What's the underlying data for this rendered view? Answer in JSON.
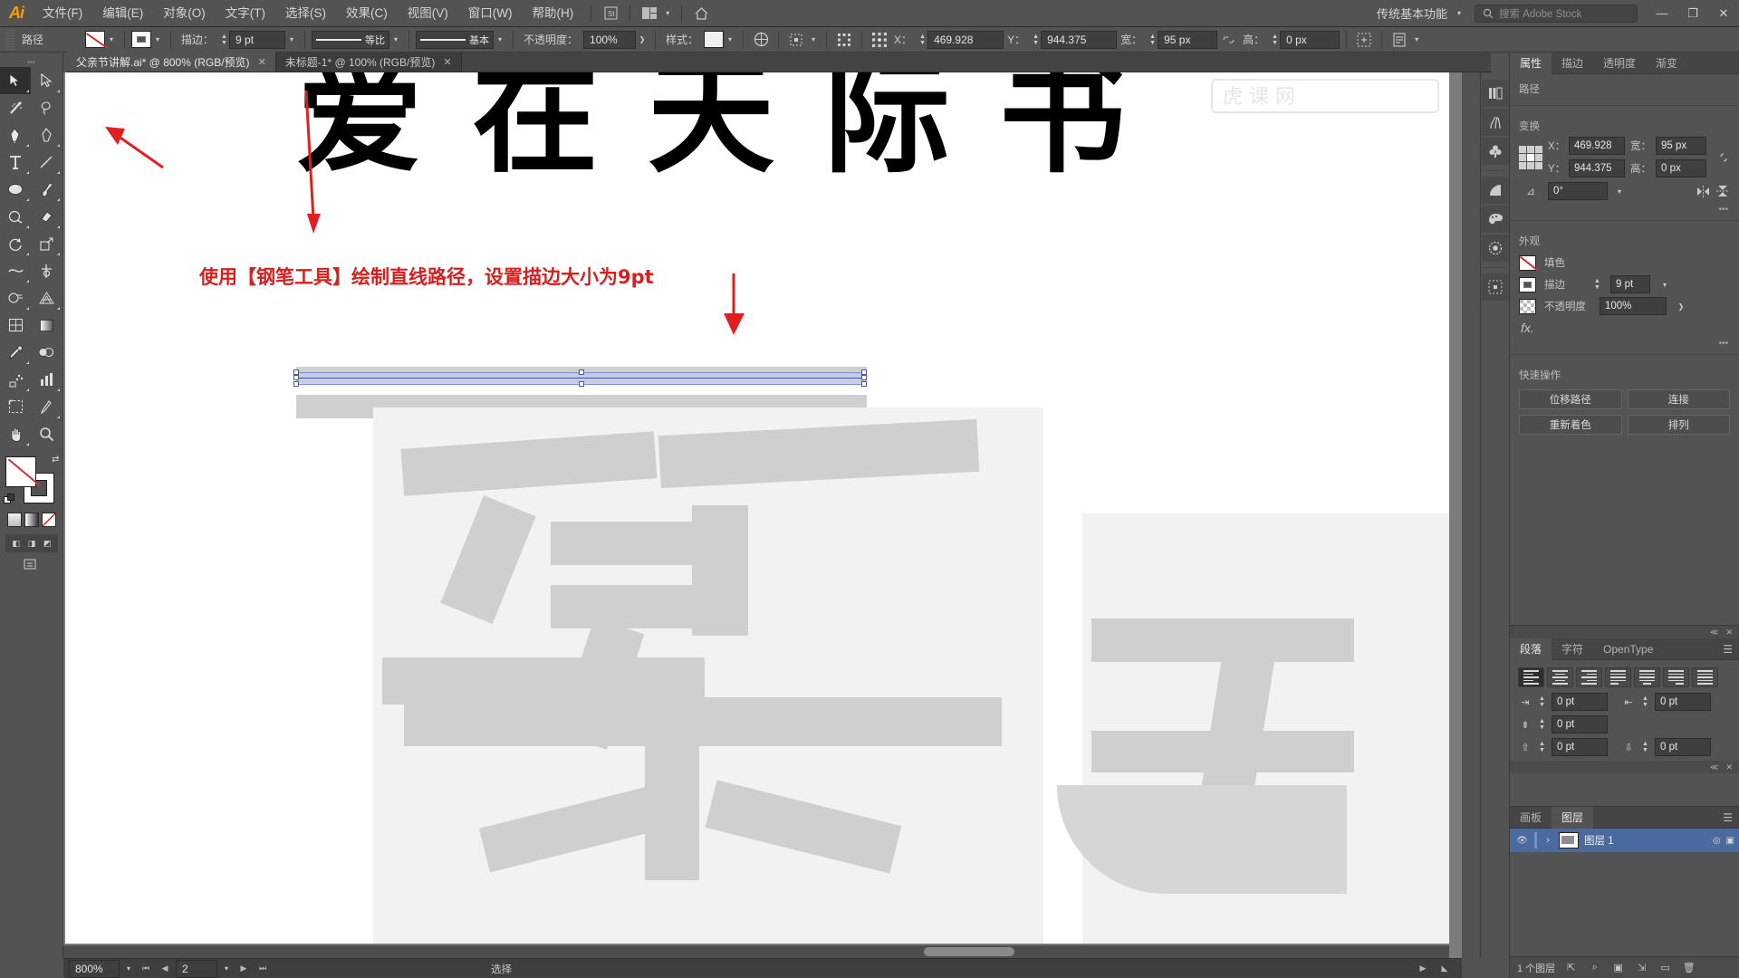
{
  "app": {
    "name": "Adobe Illustrator",
    "logo_text": "Ai"
  },
  "menubar": {
    "items": [
      {
        "label": "文件(F)"
      },
      {
        "label": "编辑(E)"
      },
      {
        "label": "对象(O)"
      },
      {
        "label": "文字(T)"
      },
      {
        "label": "选择(S)"
      },
      {
        "label": "效果(C)"
      },
      {
        "label": "视图(V)"
      },
      {
        "label": "窗口(W)"
      },
      {
        "label": "帮助(H)"
      }
    ],
    "workspace": "传统基本功能",
    "search_placeholder": "搜索 Adobe Stock",
    "window_buttons": {
      "minimize": "—",
      "maximize": "❐",
      "close": "✕"
    }
  },
  "controlbar": {
    "object_label": "路径",
    "fill_label": "填色",
    "stroke_label": "描边：",
    "stroke_weight": "9 pt",
    "stroke_profile": "等比",
    "brush_def": "基本",
    "opacity_label": "不透明度：",
    "opacity_value": "100%",
    "style_label": "样式：",
    "x_label": "X：",
    "x_value": "469.928",
    "y_label": "Y：",
    "y_value": "944.375",
    "w_label": "宽：",
    "w_value": "95 px",
    "h_label": "高：",
    "h_value": "0 px"
  },
  "tabs": [
    {
      "label": "父亲节讲解.ai* @ 800% (RGB/预览)",
      "active": true,
      "close": "✕"
    },
    {
      "label": "未标题-1* @ 100% (RGB/预览)",
      "active": false,
      "close": "✕"
    }
  ],
  "toolbar": {
    "tools": [
      {
        "name": "selection-tool",
        "glyph": "➤",
        "active": true
      },
      {
        "name": "direct-selection-tool",
        "glyph": "➢",
        "active": false
      },
      {
        "name": "magic-wand-tool",
        "glyph": "✧",
        "active": false
      },
      {
        "name": "lasso-tool",
        "glyph": "◌",
        "active": false
      },
      {
        "name": "pen-tool",
        "glyph": "✒",
        "active": false
      },
      {
        "name": "add-anchor-point-tool",
        "glyph": "✎",
        "active": false
      },
      {
        "name": "type-tool",
        "glyph": "T",
        "active": false
      },
      {
        "name": "line-segment-tool",
        "glyph": "╱",
        "active": false
      },
      {
        "name": "ellipse-tool",
        "glyph": "⬭",
        "active": false
      },
      {
        "name": "paintbrush-tool",
        "glyph": "🖌",
        "active": false
      },
      {
        "name": "shaper-tool",
        "glyph": "◔",
        "active": false
      },
      {
        "name": "eraser-tool",
        "glyph": "◇",
        "active": false
      },
      {
        "name": "rotate-tool",
        "glyph": "↻",
        "active": false
      },
      {
        "name": "scale-tool",
        "glyph": "⧉",
        "active": false
      },
      {
        "name": "width-tool",
        "glyph": "∿",
        "active": false
      },
      {
        "name": "free-transform-tool",
        "glyph": "✛",
        "active": false
      },
      {
        "name": "shape-builder-tool",
        "glyph": "◕",
        "active": false
      },
      {
        "name": "perspective-grid-tool",
        "glyph": "▦",
        "active": false
      },
      {
        "name": "mesh-tool",
        "glyph": "▩",
        "active": false
      },
      {
        "name": "gradient-tool",
        "glyph": "▤",
        "active": false
      },
      {
        "name": "eyedropper-tool",
        "glyph": "⚲",
        "active": false
      },
      {
        "name": "blend-tool",
        "glyph": "❂",
        "active": false
      },
      {
        "name": "symbol-sprayer-tool",
        "glyph": "⁂",
        "active": false
      },
      {
        "name": "column-graph-tool",
        "glyph": "▮",
        "active": false
      },
      {
        "name": "artboard-tool",
        "glyph": "⊡",
        "active": false
      },
      {
        "name": "slice-tool",
        "glyph": "✂",
        "active": false
      },
      {
        "name": "hand-tool",
        "glyph": "✋",
        "active": false
      },
      {
        "name": "zoom-tool",
        "glyph": "⌕",
        "active": false
      }
    ],
    "screen_modes": [
      "◧",
      "◨",
      "◩"
    ]
  },
  "canvas": {
    "headline_text": "爱在天际书",
    "annotation": "使用【钢笔工具】绘制直线路径，设置描边大小为9pt",
    "annotation_color": "#d81f1f",
    "selection": {
      "anchors": 6,
      "stroke_color": "#7b8fd4",
      "fill_color": "#c2cbe8"
    }
  },
  "statusbar": {
    "zoom": "800%",
    "page": "2",
    "status_text": "选择",
    "first_glyph": "⏮",
    "prev_glyph": "◀",
    "next_glyph": "▶",
    "last_glyph": "⏭"
  },
  "dockstrip": {
    "icons": [
      {
        "name": "libraries-icon",
        "glyph": "▦"
      },
      {
        "name": "brushes-icon",
        "glyph": "🖌"
      },
      {
        "name": "symbols-icon",
        "glyph": "♣"
      },
      {
        "name": "gradient-icon",
        "glyph": "◔"
      },
      {
        "name": "swatches-icon",
        "glyph": "🎨"
      },
      {
        "name": "color-guide-icon",
        "glyph": "◉"
      },
      {
        "name": "transform-icon",
        "glyph": "⛶"
      }
    ]
  },
  "properties_panel": {
    "tabs": [
      {
        "label": "属性",
        "active": true
      },
      {
        "label": "描边",
        "active": false
      },
      {
        "label": "透明度",
        "active": false
      },
      {
        "label": "渐变",
        "active": false
      }
    ],
    "object_type": "路径",
    "transform": {
      "title": "变换",
      "x_label": "X：",
      "x_value": "469.928",
      "y_label": "Y：",
      "y_value": "944.375",
      "w_label": "宽：",
      "w_value": "95 px",
      "h_label": "高：",
      "h_value": "0 px",
      "angle_label": "⊿",
      "angle_value": "0°",
      "more": "•••"
    },
    "appearance": {
      "title": "外观",
      "fill_label": "填色",
      "stroke_label": "描边",
      "stroke_value": "9 pt",
      "opacity_label": "不透明度",
      "opacity_value": "100%",
      "fx_label": "fx.",
      "more": "•••"
    },
    "quick_actions": {
      "title": "快速操作",
      "buttons": [
        "位移路径",
        "连接",
        "重新着色",
        "排列"
      ]
    }
  },
  "paragraph_panel": {
    "tabs": [
      {
        "label": "段落",
        "active": true
      },
      {
        "label": "字符",
        "active": false
      },
      {
        "label": "OpenType",
        "active": false
      }
    ],
    "align_buttons": [
      "align-left",
      "align-center",
      "align-right",
      "justify-last-left",
      "justify-last-center",
      "justify-last-right",
      "justify-all"
    ],
    "fields": [
      {
        "name": "indent-left",
        "value": "0 pt"
      },
      {
        "name": "indent-right",
        "value": "0 pt"
      },
      {
        "name": "indent-first-line",
        "value": "0 pt"
      },
      {
        "name": "space-before",
        "value": "0 pt"
      },
      {
        "name": "space-after",
        "value": "0 pt"
      }
    ]
  },
  "layers_panel": {
    "tabs": [
      {
        "label": "画板",
        "active": false
      },
      {
        "label": "图层",
        "active": true
      }
    ],
    "menu_glyph": "☰",
    "rows": [
      {
        "eye": "👁",
        "expand": "›",
        "name": "图层 1",
        "target": "◎",
        "select": "▣"
      }
    ],
    "footer_count": "1 个图层",
    "footer_icons": [
      "⇱",
      "⌕",
      "▣",
      "⇲",
      "▭",
      "🗑"
    ]
  }
}
